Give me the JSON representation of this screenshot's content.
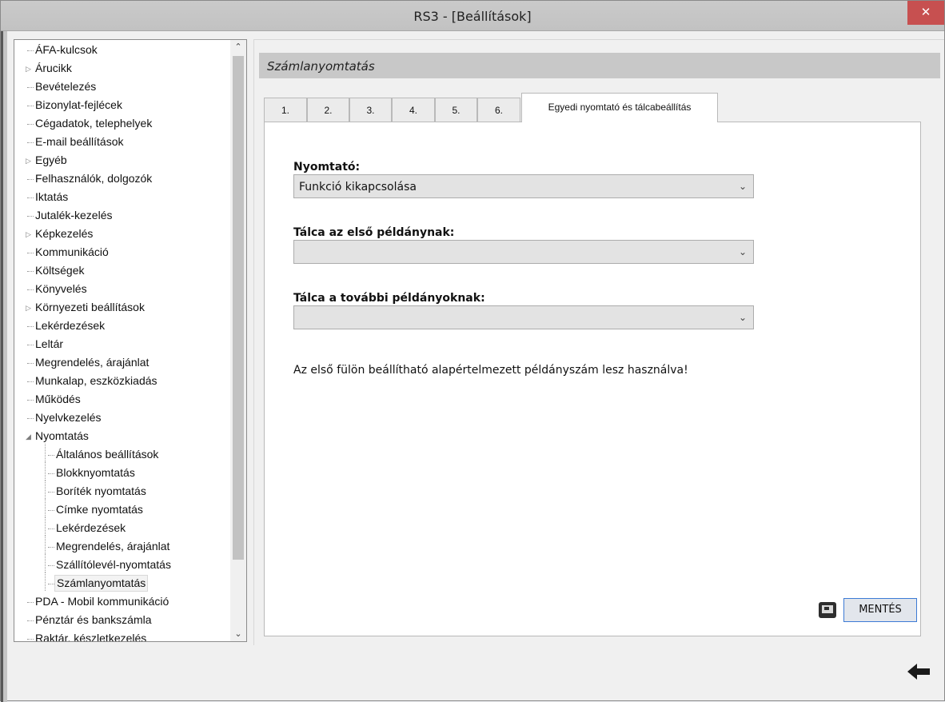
{
  "window": {
    "title": "RS3 - [Beállítások]",
    "close_label": "✕"
  },
  "tree": {
    "items": [
      {
        "label": "ÁFA-kulcsok",
        "level": 0,
        "expandable": false
      },
      {
        "label": "Árucikk",
        "level": 0,
        "expandable": true
      },
      {
        "label": "Bevételezés",
        "level": 0,
        "expandable": false
      },
      {
        "label": "Bizonylat-fejlécek",
        "level": 0,
        "expandable": false
      },
      {
        "label": "Cégadatok, telephelyek",
        "level": 0,
        "expandable": false
      },
      {
        "label": "E-mail beállítások",
        "level": 0,
        "expandable": false
      },
      {
        "label": "Egyéb",
        "level": 0,
        "expandable": true
      },
      {
        "label": "Felhasználók, dolgozók",
        "level": 0,
        "expandable": false
      },
      {
        "label": "Iktatás",
        "level": 0,
        "expandable": false
      },
      {
        "label": "Jutalék-kezelés",
        "level": 0,
        "expandable": false
      },
      {
        "label": "Képkezelés",
        "level": 0,
        "expandable": true
      },
      {
        "label": "Kommunikáció",
        "level": 0,
        "expandable": false
      },
      {
        "label": "Költségek",
        "level": 0,
        "expandable": false
      },
      {
        "label": "Könyvelés",
        "level": 0,
        "expandable": false
      },
      {
        "label": "Környezeti beállítások",
        "level": 0,
        "expandable": true
      },
      {
        "label": "Lekérdezések",
        "level": 0,
        "expandable": false
      },
      {
        "label": "Leltár",
        "level": 0,
        "expandable": false
      },
      {
        "label": "Megrendelés, árajánlat",
        "level": 0,
        "expandable": false
      },
      {
        "label": "Munkalap, eszközkiadás",
        "level": 0,
        "expandable": false
      },
      {
        "label": "Működés",
        "level": 0,
        "expandable": false
      },
      {
        "label": "Nyelvkezelés",
        "level": 0,
        "expandable": false
      },
      {
        "label": "Nyomtatás",
        "level": 0,
        "expandable": true,
        "expanded": true
      },
      {
        "label": "Általános beállítások",
        "level": 1,
        "expandable": false
      },
      {
        "label": "Blokknyomtatás",
        "level": 1,
        "expandable": false
      },
      {
        "label": "Boríték nyomtatás",
        "level": 1,
        "expandable": false
      },
      {
        "label": "Címke nyomtatás",
        "level": 1,
        "expandable": false
      },
      {
        "label": "Lekérdezések",
        "level": 1,
        "expandable": false
      },
      {
        "label": "Megrendelés, árajánlat",
        "level": 1,
        "expandable": false
      },
      {
        "label": "Szállítólevél-nyomtatás",
        "level": 1,
        "expandable": false
      },
      {
        "label": "Számlanyomtatás",
        "level": 1,
        "expandable": false,
        "selected": true
      },
      {
        "label": "PDA - Mobil kommunikáció",
        "level": 0,
        "expandable": false
      },
      {
        "label": "Pénztár és bankszámla",
        "level": 0,
        "expandable": false
      },
      {
        "label": "Raktár, készletkezelés",
        "level": 0,
        "expandable": false
      }
    ],
    "scroll_up_icon": "chevron-up-icon",
    "scroll_down_icon": "chevron-down-icon"
  },
  "content": {
    "section_title": "Számlanyomtatás",
    "tabs": [
      {
        "label": "1."
      },
      {
        "label": "2."
      },
      {
        "label": "3."
      },
      {
        "label": "4."
      },
      {
        "label": "5."
      },
      {
        "label": "6."
      },
      {
        "label": "Egyedi nyomtató és tálcabeállítás",
        "active": true
      }
    ],
    "printer": {
      "label": "Nyomtató:",
      "value": "Funkció kikapcsolása"
    },
    "first_tray": {
      "label": "Tálca az első példánynak:",
      "value": ""
    },
    "other_tray": {
      "label": "Tálca a további példányoknak:",
      "value": ""
    },
    "info": "Az első fülön beállítható alapértelmezett példányszám lesz használva!",
    "save_label": "MENTÉS",
    "save_icon": "screen-icon"
  },
  "footer": {
    "back_icon": "back-arrow-icon"
  }
}
